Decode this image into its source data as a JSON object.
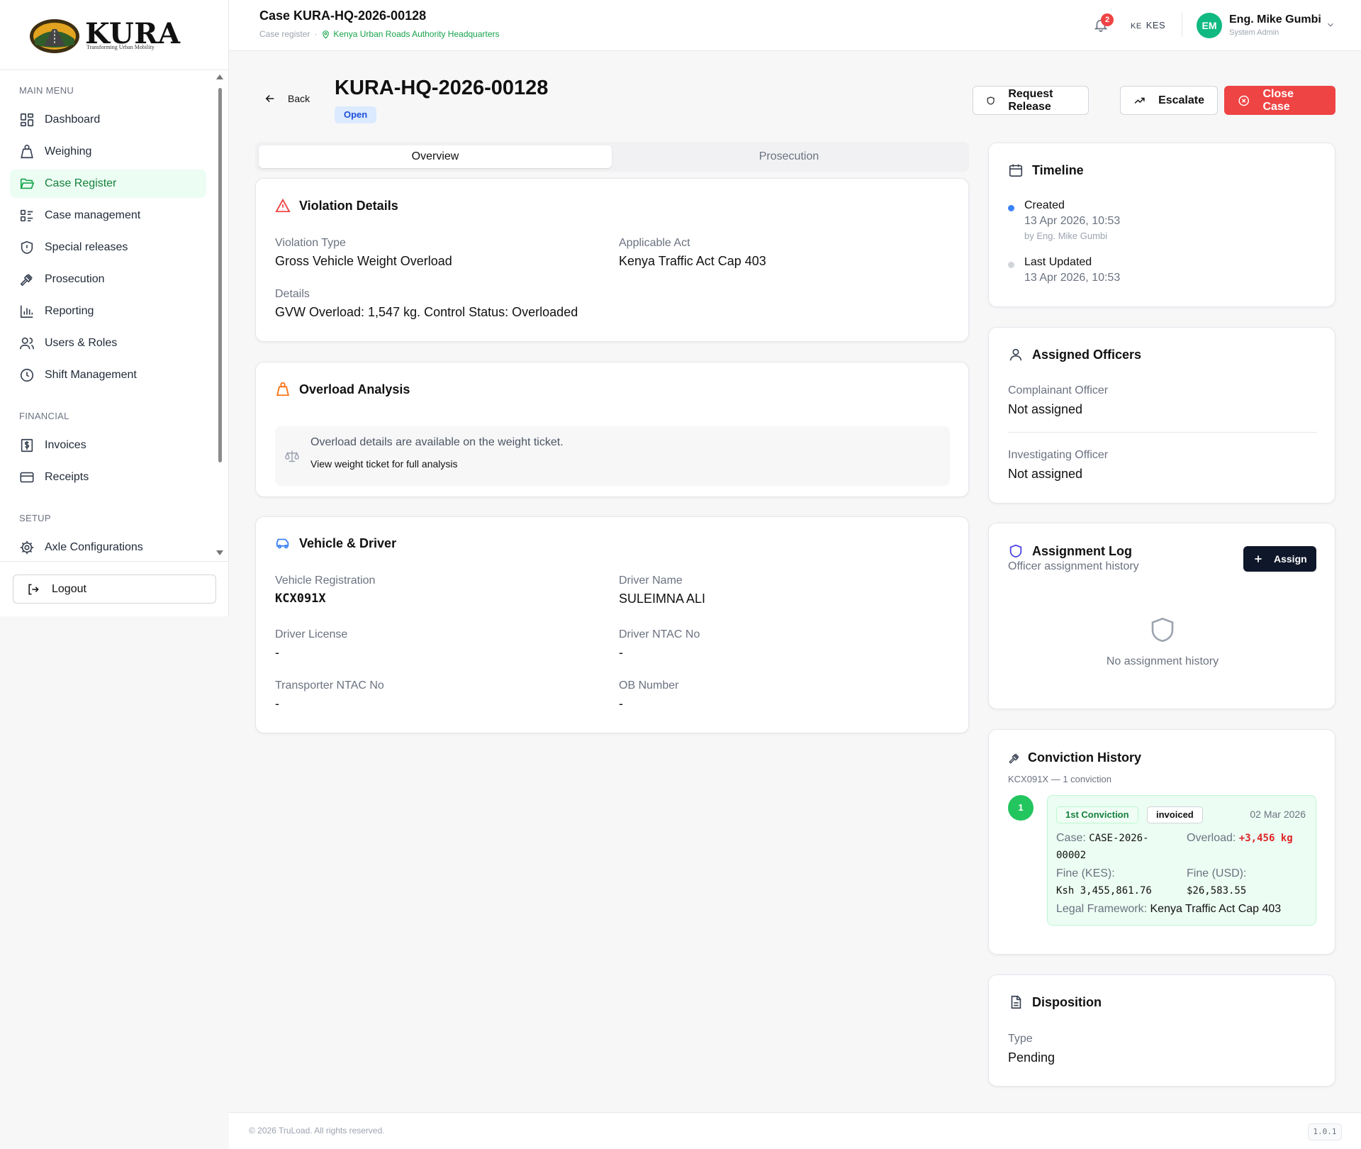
{
  "sidebar": {
    "logo_word": "KURA",
    "logo_tagline": "Transforming Urban Mobility",
    "sections": {
      "main": "MAIN MENU",
      "financial": "FINANCIAL",
      "setup": "SETUP"
    },
    "items": [
      {
        "label": "Dashboard",
        "icon": "dashboard-icon",
        "active": false
      },
      {
        "label": "Weighing",
        "icon": "weight-icon",
        "active": false
      },
      {
        "label": "Case Register",
        "icon": "folder-open-icon",
        "active": true
      },
      {
        "label": "Case management",
        "icon": "list-icon",
        "active": false
      },
      {
        "label": "Special releases",
        "icon": "shield-icon",
        "active": false
      },
      {
        "label": "Prosecution",
        "icon": "gavel-icon",
        "active": false
      },
      {
        "label": "Reporting",
        "icon": "bar-chart-icon",
        "active": false
      },
      {
        "label": "Users & Roles",
        "icon": "users-icon",
        "active": false
      },
      {
        "label": "Shift Management",
        "icon": "clock-icon",
        "active": false
      },
      {
        "label": "Invoices",
        "icon": "invoice-icon",
        "active": false
      },
      {
        "label": "Receipts",
        "icon": "card-icon",
        "active": false
      },
      {
        "label": "Axle Configurations",
        "icon": "gear-icon",
        "active": false
      }
    ],
    "logout": "Logout"
  },
  "topbar": {
    "title": "Case KURA-HQ-2026-00128",
    "crumb": "Case register",
    "crumb_sep": "·",
    "location": "Kenya Urban Roads Authority Headquarters",
    "notif_count": "2",
    "currency_flag": "KE",
    "currency": "KES",
    "user_initials": "EM",
    "user_name": "Eng. Mike Gumbi",
    "user_role": "System Admin"
  },
  "header": {
    "back": "Back",
    "case_id": "KURA-HQ-2026-00128",
    "status": "Open",
    "request_release": "Request Release",
    "escalate": "Escalate",
    "close_case": "Close Case"
  },
  "tabs": [
    "Overview",
    "Prosecution"
  ],
  "violation": {
    "title": "Violation Details",
    "type_label": "Violation Type",
    "type_value": "Gross Vehicle Weight Overload",
    "act_label": "Applicable Act",
    "act_value": "Kenya Traffic Act Cap 403",
    "details_label": "Details",
    "details_value": "GVW Overload: 1,547 kg. Control Status: Overloaded"
  },
  "overload": {
    "title": "Overload Analysis",
    "message": "Overload details are available on the weight ticket.",
    "link": "View weight ticket for full analysis"
  },
  "vehicle": {
    "title": "Vehicle & Driver",
    "reg_label": "Vehicle Registration",
    "reg_value": "KCX091X",
    "driver_label": "Driver Name",
    "driver_value": "SULEIMNA ALI",
    "license_label": "Driver License",
    "license_value": "-",
    "ntac_label": "Driver NTAC No",
    "ntac_value": "-",
    "transporter_label": "Transporter NTAC No",
    "transporter_value": "-",
    "ob_label": "OB Number",
    "ob_value": "-"
  },
  "timeline": {
    "title": "Timeline",
    "created_label": "Created",
    "created_date": "13 Apr 2026, 10:53",
    "created_by": "by Eng. Mike Gumbi",
    "updated_label": "Last Updated",
    "updated_date": "13 Apr 2026, 10:53"
  },
  "officers": {
    "title": "Assigned Officers",
    "complainant_label": "Complainant Officer",
    "complainant_value": "Not assigned",
    "investigating_label": "Investigating Officer",
    "investigating_value": "Not assigned"
  },
  "assign_log": {
    "title": "Assignment Log",
    "subtitle": "Officer assignment history",
    "button": "Assign",
    "empty": "No assignment history"
  },
  "conviction": {
    "title": "Conviction History",
    "subtitle": "KCX091X — 1 conviction",
    "number": "1",
    "badge": "1st Conviction",
    "status": "invoiced",
    "date": "02 Mar 2026",
    "case_label": "Case:",
    "case_value_1": "CASE-2026-",
    "case_value_2": "00002",
    "overload_label": "Overload:",
    "overload_value": "+3,456 kg",
    "fine_kes_label": "Fine (KES):",
    "fine_kes_value": "Ksh 3,455,861.76",
    "fine_usd_label": "Fine (USD):",
    "fine_usd_value": "$26,583.55",
    "framework_label": "Legal Framework:",
    "framework_value": "Kenya Traffic Act Cap 403"
  },
  "disposition": {
    "title": "Disposition",
    "type_label": "Type",
    "type_value": "Pending"
  },
  "footer": {
    "copyright": "© 2026 TruLoad. All rights reserved.",
    "version": "1.0.1"
  },
  "colors": {
    "accent_green": "#16a34a",
    "danger_red": "#ef4444",
    "status_blue": "#1d4ed8",
    "dark_button": "#0f172a"
  }
}
